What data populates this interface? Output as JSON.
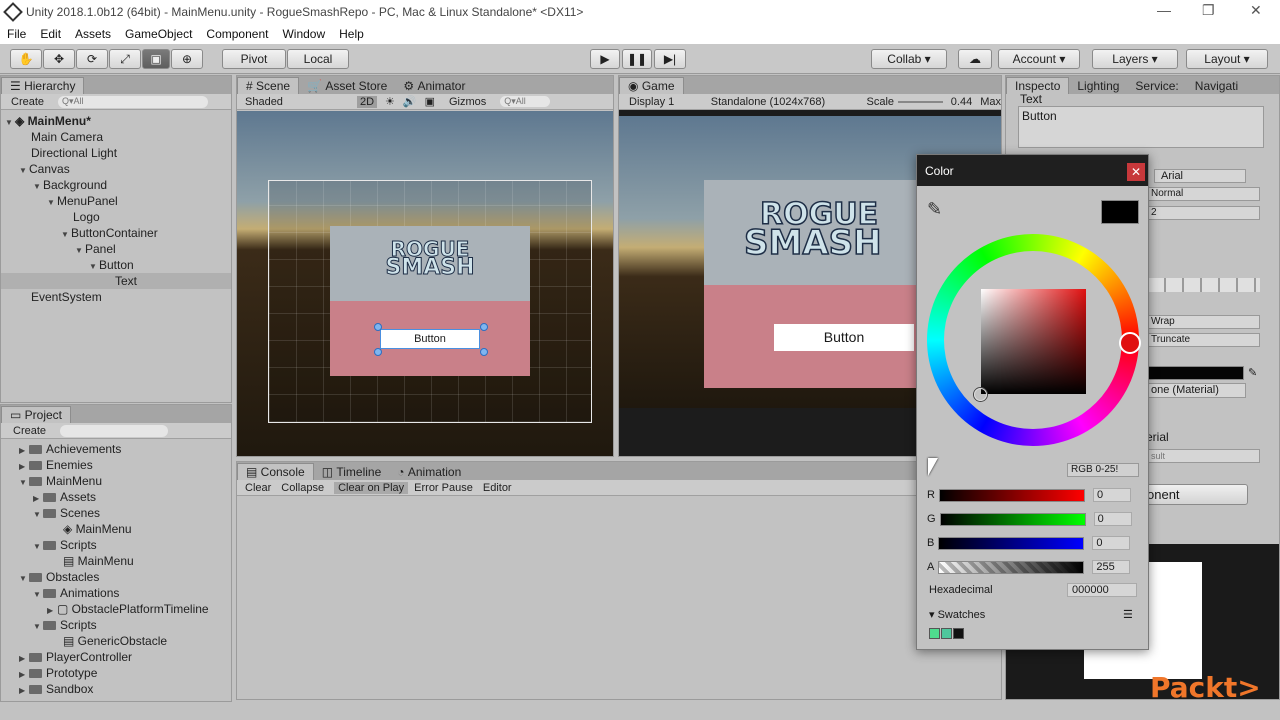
{
  "window": {
    "title": "Unity 2018.1.0b12 (64bit) - MainMenu.unity - RogueSmashRepo - PC, Mac & Linux Standalone* <DX11>"
  },
  "menu": [
    "File",
    "Edit",
    "Assets",
    "GameObject",
    "Component",
    "Window",
    "Help"
  ],
  "toolbar": {
    "pivot": "Pivot",
    "local": "Local",
    "collab": "Collab",
    "account": "Account",
    "layers": "Layers",
    "layout": "Layout"
  },
  "hierarchy": {
    "tab": "Hierarchy",
    "create": "Create",
    "search": "Q▾All",
    "scene": "MainMenu*",
    "items": [
      "Main Camera",
      "Directional Light",
      "Canvas",
      "Background",
      "MenuPanel",
      "Logo",
      "ButtonContainer",
      "Panel",
      "Button",
      "Text",
      "EventSystem"
    ]
  },
  "scene": {
    "tabs": [
      "Scene",
      "Asset Store",
      "Animator"
    ],
    "shaded": "Shaded",
    "mode": "2D",
    "gizmos": "Gizmos",
    "search": "Q▾All",
    "button": "Button",
    "logo_top": "ROGUE",
    "logo_bottom": "SMASH"
  },
  "game": {
    "tab": "Game",
    "display": "Display 1",
    "resolution": "Standalone (1024x768)",
    "scale_label": "Scale",
    "scale": "0.44",
    "max": "Max",
    "button": "Button",
    "logo_top": "ROGUE",
    "logo_bottom": "SMASH"
  },
  "inspector": {
    "tabs": [
      "Inspecto",
      "Lighting",
      "Service:",
      "Navigati"
    ],
    "text_label": "Text",
    "text_value": "Button",
    "font": "Arial",
    "style": "Normal",
    "size": "2",
    "wrap": "Wrap",
    "truncate": "Truncate",
    "material": "one (Material)",
    "section": "erial",
    "subsection": "sult",
    "add": "onent"
  },
  "project": {
    "tab": "Project",
    "create": "Create",
    "folders": [
      "Achievements",
      "Enemies",
      "MainMenu",
      "Assets",
      "Scenes",
      "MainMenu",
      "Scripts",
      "MainMenu",
      "Obstacles",
      "Animations",
      "ObstaclePlatformTimeline",
      "Scripts",
      "GenericObstacle",
      "PlayerController",
      "Prototype",
      "Sandbox"
    ]
  },
  "console": {
    "tabs": [
      "Console",
      "Timeline",
      "Animation"
    ],
    "buttons": [
      "Clear",
      "Collapse",
      "Clear on Play",
      "Error Pause",
      "Editor"
    ]
  },
  "color_picker": {
    "title": "Color",
    "mode": "RGB 0-25!",
    "r_label": "R",
    "r": "0",
    "g_label": "G",
    "g": "0",
    "b_label": "B",
    "b": "0",
    "a_label": "A",
    "a": "255",
    "hex_label": "Hexadecimal",
    "hex": "000000",
    "swatches_label": "Swatches",
    "swatch_colors": [
      "#4fdc8e",
      "#4ec79c",
      "#111111"
    ],
    "current_color": "#000000",
    "hue_color": "#e01010"
  },
  "watermark": "Packt>"
}
